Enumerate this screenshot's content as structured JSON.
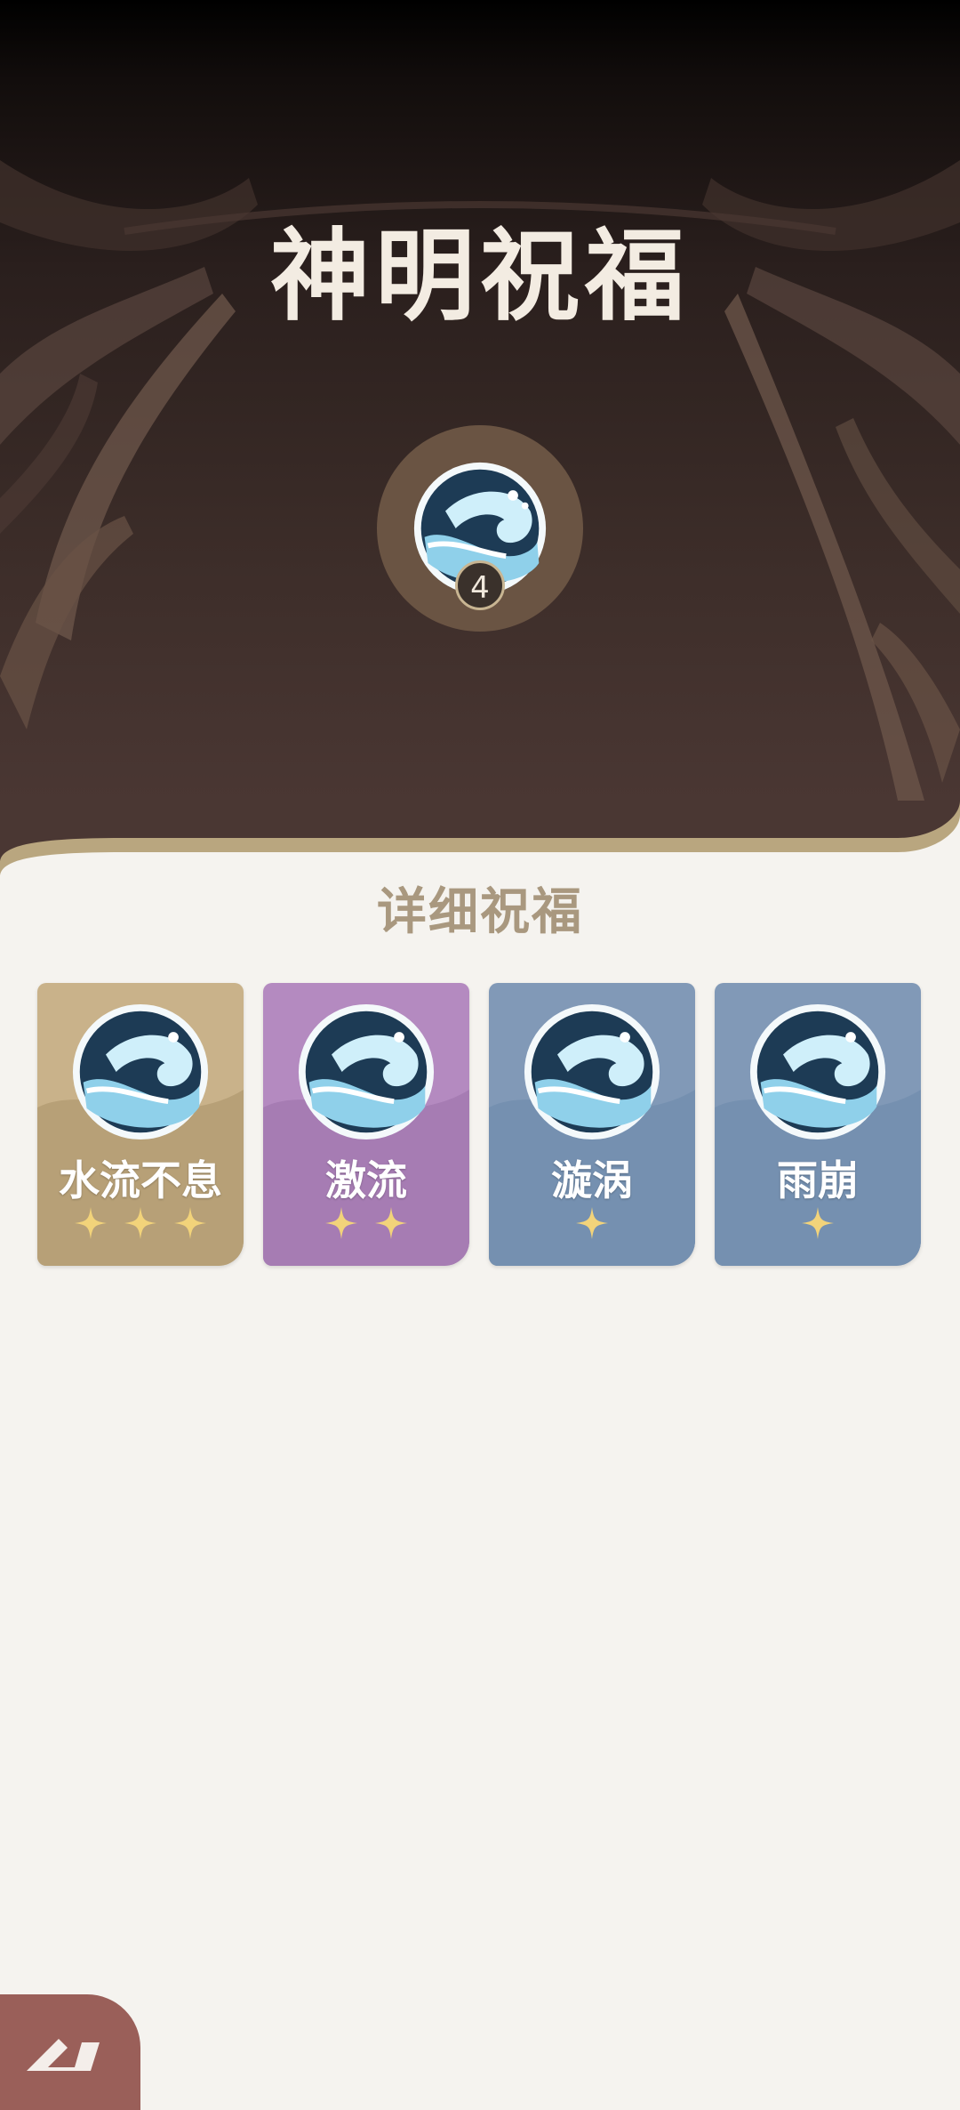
{
  "header": {
    "title": "神明祝福"
  },
  "emblem": {
    "icon": "water-wave-icon",
    "count": "4"
  },
  "details": {
    "title": "详细祝福",
    "cards": [
      {
        "name": "水流不息",
        "stars": 3,
        "tier_color": "#c9b28a",
        "icon": "water-wave-icon"
      },
      {
        "name": "激流",
        "stars": 2,
        "tier_color": "#b48ac0",
        "icon": "water-wave-icon"
      },
      {
        "name": "漩涡",
        "stars": 1,
        "tier_color": "#8199b7",
        "icon": "water-wave-icon"
      },
      {
        "name": "雨崩",
        "stars": 1,
        "tier_color": "#8199b7",
        "icon": "water-wave-icon"
      }
    ]
  },
  "colors": {
    "star": "#f2d37a",
    "panel_border": "#b9a67f",
    "back_button": "#9a5f59"
  },
  "footer": {
    "back_icon": "back-arrow-icon"
  }
}
